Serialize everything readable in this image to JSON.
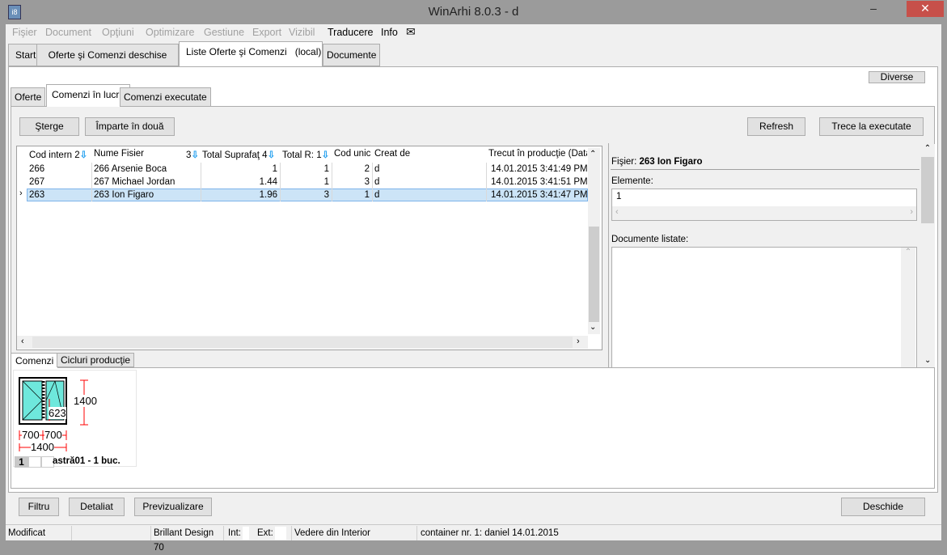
{
  "window": {
    "title": "WinArhi 8.0.3 - d",
    "icon": "app-icon",
    "minimize": "–",
    "close": "✕"
  },
  "menu": [
    {
      "label": "Fişier",
      "enabled": false
    },
    {
      "label": "Document",
      "enabled": false
    },
    {
      "label": "Opţiuni",
      "enabled": false
    },
    {
      "label": "Optimizare",
      "enabled": false
    },
    {
      "label": "Gestiune",
      "enabled": false
    },
    {
      "label": "Export",
      "enabled": false
    },
    {
      "label": "Vizibil",
      "enabled": false
    },
    {
      "label": "Traducere",
      "enabled": true
    },
    {
      "label": "Info",
      "enabled": true
    },
    {
      "label": "✉",
      "enabled": true
    }
  ],
  "main_tabs": [
    "Start",
    "Oferte şi Comenzi deschise",
    "Liste Oferte şi Comenzi   (local)",
    "Documente"
  ],
  "diverse": "Diverse",
  "sub_tabs": [
    "Oferte",
    "Comenzi în lucru",
    "Comenzi executate"
  ],
  "toolbar": {
    "delete": "Şterge",
    "split": "Împarte în două",
    "refresh": "Refresh",
    "move": "Trece la executate"
  },
  "grid": {
    "columns": [
      {
        "label": "Cod intern",
        "sort": "2"
      },
      {
        "label": "Nume Fisier",
        "sort": "3"
      },
      {
        "label": "Total Suprafaţ",
        "sort": "4"
      },
      {
        "label": "Total R:",
        "sort": "1"
      },
      {
        "label": "Cod unic",
        "sort": ""
      },
      {
        "label": "Creat de",
        "sort": ""
      },
      {
        "label": "Trecut în producţie (Data)",
        "sort": ""
      }
    ],
    "rows": [
      [
        "266",
        "266 Arsenie Boca",
        "1",
        "1",
        "2",
        "d",
        "14.01.2015 3:41:49 PM"
      ],
      [
        "267",
        "267 Michael Jordan",
        "1.44",
        "1",
        "3",
        "d",
        "14.01.2015 3:41:51 PM"
      ],
      [
        "263",
        "263 Ion Figaro",
        "1.96",
        "3",
        "1",
        "d",
        "14.01.2015 3:41:47 PM"
      ]
    ],
    "selected_row": 2
  },
  "details": {
    "file_label": "Fişier:",
    "file_value": "263 Ion Figaro",
    "elements_label": "Elemente:",
    "elements_value": "1",
    "docs_label": "Documente listate:"
  },
  "bottom_tabs": [
    "Comenzi",
    "Cicluri producţie"
  ],
  "item": {
    "height": "1400",
    "width_total": "1400",
    "left": "700",
    "right": "700",
    "handle": "623",
    "index": "1",
    "caption": "astră01 - 1 buc."
  },
  "footer": {
    "filter": "Filtru",
    "detail": "Detaliat",
    "preview": "Previzualizare",
    "open": "Deschide"
  },
  "status": {
    "state": "Modificat",
    "profile": "Brillant Design 70",
    "int": "Int:",
    "ext": "Ext:",
    "view": "Vedere din Interior",
    "container": "container nr. 1: daniel 14.01.2015"
  }
}
